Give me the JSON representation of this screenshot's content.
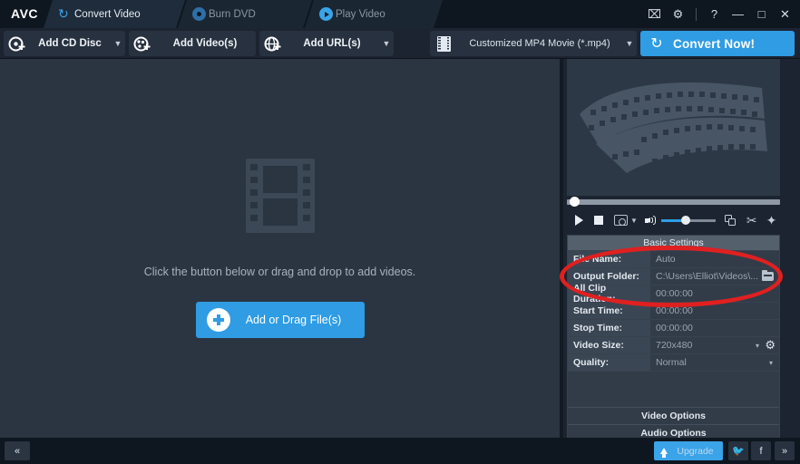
{
  "window": {
    "logo": "AVC",
    "controls": [
      {
        "name": "register-icon",
        "glyph": "⌧"
      },
      {
        "name": "settings-gear-icon",
        "glyph": "⚙"
      },
      {
        "name": "help-icon",
        "glyph": "?"
      },
      {
        "name": "minimize-icon",
        "glyph": "—"
      },
      {
        "name": "maximize-icon",
        "glyph": "□"
      },
      {
        "name": "close-icon",
        "glyph": "✕"
      }
    ]
  },
  "tabs": [
    {
      "label": "Convert Video",
      "icon": "sync-icon",
      "active": true
    },
    {
      "label": "Burn DVD",
      "icon": "disc-icon",
      "active": false
    },
    {
      "label": "Play Video",
      "icon": "play-circle-icon",
      "active": false
    }
  ],
  "toolbar": {
    "add_cd_disc": "Add CD Disc",
    "add_videos": "Add Video(s)",
    "add_urls": "Add URL(s)",
    "profile_value": "Customized MP4 Movie (*.mp4)",
    "convert_now": "Convert Now!",
    "caret": "▼"
  },
  "dropzone": {
    "hint": "Click the button below or drag and drop to add videos.",
    "add_button": "Add or Drag File(s)"
  },
  "media_controls": {
    "play": "play-icon",
    "stop": "stop-icon",
    "snapshot": "snapshot-icon",
    "snapshot_caret": "▼",
    "volume": "volume-icon",
    "merge": "merge-icon",
    "cut": "✂",
    "effects": "✦",
    "volume_percent": 45,
    "seek_percent": 2
  },
  "settings": {
    "header": "Basic Settings",
    "rows": [
      {
        "label": "File Name:",
        "value": "Auto",
        "control": "text"
      },
      {
        "label": "Output Folder:",
        "value": "C:\\Users\\Elliot\\Videos\\...",
        "control": "folder"
      },
      {
        "label": "All Clip Duration:",
        "value": "00:00:00",
        "control": "text"
      },
      {
        "label": "Start Time:",
        "value": "00:00:00",
        "control": "text"
      },
      {
        "label": "Stop Time:",
        "value": "00:00:00",
        "control": "text"
      },
      {
        "label": "Video Size:",
        "value": "720x480",
        "control": "select-gear"
      },
      {
        "label": "Quality:",
        "value": "Normal",
        "control": "select"
      }
    ],
    "options": [
      {
        "label": "Video Options"
      },
      {
        "label": "Audio Options"
      }
    ],
    "caret": "▾",
    "gear": "⚙"
  },
  "statusbar": {
    "collapse": "«",
    "upgrade": "Upgrade",
    "twitter": "🐦",
    "facebook": "f",
    "next": "»"
  },
  "colors": {
    "accent": "#2f9ce4",
    "panel": "#1b2430",
    "dropzone": "#2a3541",
    "annotation": "#e02020",
    "titlebar": "#0e1620"
  }
}
